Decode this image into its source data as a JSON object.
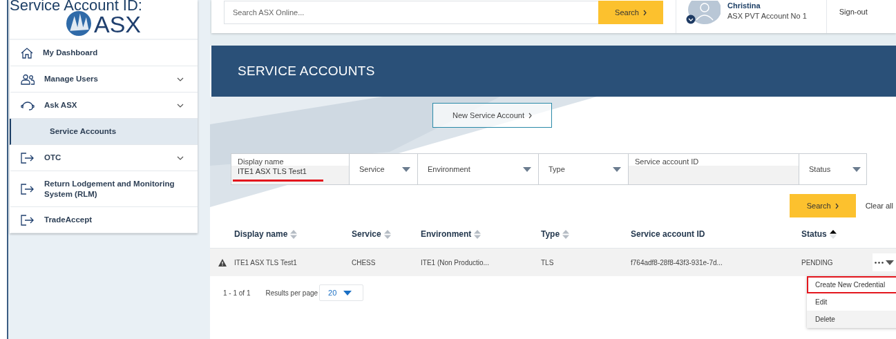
{
  "page_heading": "Service Account ID:",
  "logo": {
    "text": "ASX"
  },
  "sidebar": {
    "items": [
      {
        "kind": "home",
        "label": "My Dashboard",
        "expandable": false,
        "selected": false
      },
      {
        "kind": "users",
        "label": "Manage Users",
        "expandable": true,
        "selected": false
      },
      {
        "kind": "headset",
        "label": "Ask ASX",
        "expandable": true,
        "selected": false
      },
      {
        "kind": "sub",
        "label": "Service Accounts",
        "expandable": false,
        "selected": true
      },
      {
        "kind": "exit",
        "label": "OTC",
        "expandable": true,
        "selected": false
      },
      {
        "kind": "exit",
        "label": "Return Lodgement and Monitoring System (RLM)",
        "expandable": false,
        "selected": false
      },
      {
        "kind": "exit",
        "label": "TradeAccept",
        "expandable": false,
        "selected": false
      }
    ]
  },
  "topbar": {
    "search": {
      "placeholder": "Search ASX Online..."
    },
    "search_button": "Search",
    "user": {
      "name": "Christina",
      "account": "ASX PVT Account No 1"
    },
    "signout": "Sign-out"
  },
  "banner": {
    "title": "SERVICE ACCOUNTS"
  },
  "new_button": "New Service Account",
  "filters": [
    {
      "kind": "text",
      "label": "Display name",
      "value": "ITE1 ASX TLS Test1",
      "underlined": true
    },
    {
      "kind": "select",
      "label": "Service"
    },
    {
      "kind": "select",
      "label": "Environment"
    },
    {
      "kind": "select",
      "label": "Type"
    },
    {
      "kind": "text",
      "label": "Service account ID",
      "underlined": false
    },
    {
      "kind": "select",
      "label": "Status"
    }
  ],
  "search_button": "Search",
  "clear_button": "Clear all",
  "table": {
    "columns": [
      {
        "label": "Display name",
        "sortable": true,
        "sorted": false
      },
      {
        "label": "Service",
        "sortable": true,
        "sorted": false
      },
      {
        "label": "Environment",
        "sortable": true,
        "sorted": false
      },
      {
        "label": "Type",
        "sortable": true,
        "sorted": false
      },
      {
        "label": "Service account ID",
        "sortable": false
      },
      {
        "label": "Status",
        "sortable": true,
        "sorted": true
      }
    ],
    "rows": [
      {
        "warning": true,
        "cells": [
          "ITE1 ASX TLS Test1",
          "CHESS",
          "ITE1 (Non Productio...",
          "TLS",
          "f764adf8-28f8-43f3-931e-7d...",
          "PENDING"
        ]
      }
    ]
  },
  "pagination": {
    "range": "1 - 1 of 1",
    "per_page_label": "Results per page",
    "per_page": "20"
  },
  "row_menu": [
    {
      "label": "Create New Credential",
      "highlighted": true,
      "hovered": false
    },
    {
      "label": "Edit",
      "highlighted": false,
      "hovered": false
    },
    {
      "label": "Delete",
      "highlighted": false,
      "hovered": true
    }
  ]
}
